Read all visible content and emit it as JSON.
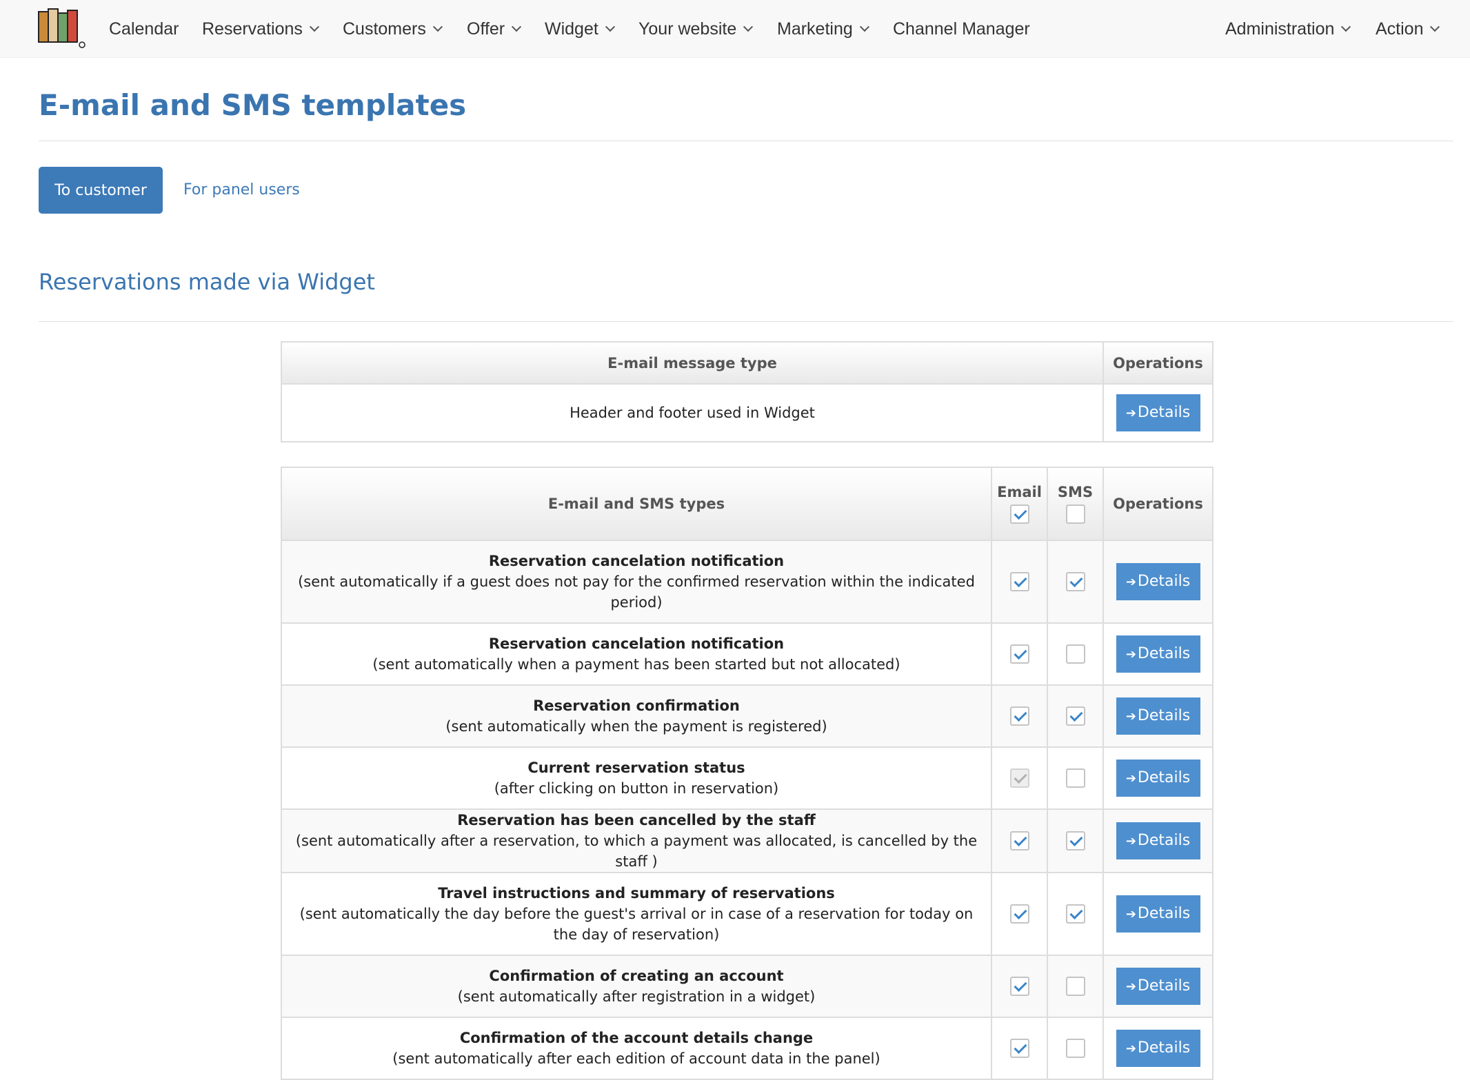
{
  "nav": {
    "items": [
      {
        "label": "Calendar",
        "dropdown": false
      },
      {
        "label": "Reservations",
        "dropdown": true
      },
      {
        "label": "Customers",
        "dropdown": true
      },
      {
        "label": "Offer",
        "dropdown": true
      },
      {
        "label": "Widget",
        "dropdown": true
      },
      {
        "label": "Your website",
        "dropdown": true
      },
      {
        "label": "Marketing",
        "dropdown": true
      },
      {
        "label": "Channel Manager",
        "dropdown": false
      }
    ],
    "right_items": [
      {
        "label": "Administration",
        "dropdown": true
      },
      {
        "label": "Action",
        "dropdown": true
      }
    ]
  },
  "page": {
    "title": "E-mail and SMS templates",
    "tabs": {
      "active": "To customer",
      "other": "For panel users"
    },
    "section_title": "Reservations made via Widget"
  },
  "header_table": {
    "col_type": "E-mail message type",
    "col_ops": "Operations",
    "row_label": "Header and footer used in Widget",
    "details_label": "Details"
  },
  "types_table": {
    "col_type": "E-mail and SMS types",
    "col_email": "Email",
    "col_sms": "SMS",
    "col_ops": "Operations",
    "header_email_checked": true,
    "header_sms_checked": false,
    "details_label": "Details",
    "rows": [
      {
        "title": "Reservation cancelation notification",
        "desc": "(sent automatically if a guest does not pay for the confirmed reservation within the indicated period)",
        "email": true,
        "sms": true,
        "email_disabled": false
      },
      {
        "title": "Reservation cancelation notification",
        "desc": "(sent automatically when a payment has been started but not allocated)",
        "email": true,
        "sms": false,
        "email_disabled": false
      },
      {
        "title": "Reservation confirmation",
        "desc": "(sent automatically when the payment is registered)",
        "email": true,
        "sms": true,
        "email_disabled": false
      },
      {
        "title": "Current reservation status",
        "desc": "(after clicking on button in reservation)",
        "email": true,
        "sms": false,
        "email_disabled": true
      },
      {
        "title": "Reservation has been cancelled by the staff",
        "desc": "(sent automatically after a reservation, to which a payment was allocated, is cancelled by the staff )",
        "email": true,
        "sms": true,
        "email_disabled": false
      },
      {
        "title": "Travel instructions and summary of reservations",
        "desc": "(sent automatically the day before the guest's arrival or in case of a reservation for today on the day of reservation)",
        "email": true,
        "sms": true,
        "email_disabled": false
      },
      {
        "title": "Confirmation of creating an account",
        "desc": "(sent automatically after registration in a widget)",
        "email": true,
        "sms": false,
        "email_disabled": false
      },
      {
        "title": "Confirmation of the account details change",
        "desc": "(sent automatically after each edition of account data in the panel)",
        "email": true,
        "sms": false,
        "email_disabled": false
      }
    ]
  },
  "colors": {
    "accent": "#3a75b0",
    "button": "#4e8fcf",
    "check": "#3a85c9"
  },
  "icons": {
    "logo": "app-logo-icon",
    "details": "arrow-right-icon",
    "dropdown": "chevron-down-icon"
  }
}
